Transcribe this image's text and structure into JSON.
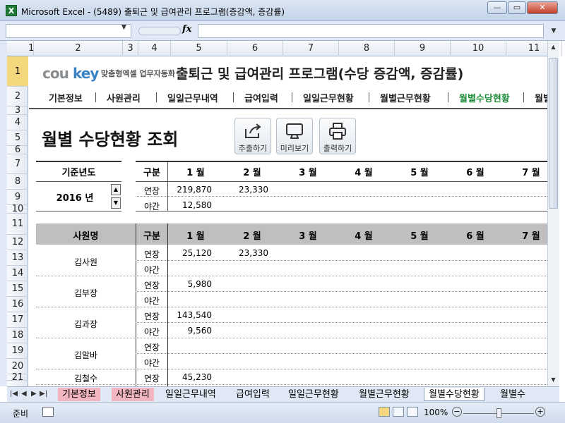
{
  "window": {
    "title": "Microsoft Excel - (5489) 출퇴근 및 급여관리 프로그램(증감액, 증감률)",
    "icon_letter": "X",
    "minimize": "—",
    "restore": "▭",
    "close": "✕"
  },
  "formula_bar": {
    "name_box": "",
    "fx": "fx",
    "formula": ""
  },
  "columns": [
    "1",
    "2",
    "3",
    "4",
    "5",
    "6",
    "7",
    "8",
    "9",
    "10",
    "11"
  ],
  "rows": [
    "1",
    "2",
    "3",
    "4",
    "5",
    "6",
    "7",
    "8",
    "9",
    "10",
    "11",
    "12",
    "13",
    "14",
    "15",
    "16",
    "17",
    "18",
    "19",
    "20",
    "21"
  ],
  "sheet": {
    "logo_cou": "cou",
    "logo_key": "key",
    "logo_sub": "맞춤형엑셀 업무자동화",
    "app_title": "출퇴근 및 급여관리 프로그램(수당 증감액, 증감률)",
    "menu": [
      "기본정보",
      "사원관리",
      "일일근무내역",
      "급여입력",
      "일일근무현황",
      "월별근무현황",
      "월별수당현황",
      "월별"
    ],
    "active_menu_index": 6,
    "page_title": "월별 수당현황 조회",
    "buttons": {
      "export": "추출하기",
      "preview": "미리보기",
      "print": "출력하기"
    },
    "summary": {
      "year_header": "기준년도",
      "year_value": "2016 년",
      "type_header": "구분",
      "months": [
        "1 월",
        "2 월",
        "3 월",
        "4 월",
        "5 월",
        "6 월",
        "7 월"
      ],
      "rows": [
        {
          "type": "연장",
          "values": [
            "219,870",
            "23,330",
            "",
            "",
            "",
            "",
            ""
          ]
        },
        {
          "type": "야간",
          "values": [
            "12,580",
            "",
            "",
            "",
            "",
            "",
            ""
          ]
        }
      ]
    },
    "detail": {
      "name_header": "사원명",
      "type_header": "구분",
      "employees": [
        {
          "name": "김사원",
          "rows": [
            {
              "type": "연장",
              "values": [
                "25,120",
                "23,330"
              ]
            },
            {
              "type": "야간",
              "values": [
                "",
                ""
              ]
            }
          ]
        },
        {
          "name": "김부장",
          "rows": [
            {
              "type": "연장",
              "values": [
                "5,980",
                ""
              ]
            },
            {
              "type": "야간",
              "values": [
                "",
                ""
              ]
            }
          ]
        },
        {
          "name": "김과장",
          "rows": [
            {
              "type": "연장",
              "values": [
                "143,540",
                ""
              ]
            },
            {
              "type": "야간",
              "values": [
                "9,560",
                ""
              ]
            }
          ]
        },
        {
          "name": "김알바",
          "rows": [
            {
              "type": "연장",
              "values": [
                "",
                ""
              ]
            },
            {
              "type": "야간",
              "values": [
                "",
                ""
              ]
            }
          ]
        },
        {
          "name": "김철수",
          "rows": [
            {
              "type": "연장",
              "values": [
                "45,230",
                ""
              ]
            }
          ]
        }
      ]
    }
  },
  "tabs": [
    "기본정보",
    "사원관리",
    "일일근무내역",
    "급여입력",
    "일일근무현황",
    "월별근무현황",
    "월별수당현황",
    "월별수"
  ],
  "active_tab_index": 6,
  "status": {
    "ready": "준비",
    "zoom": "100%"
  },
  "colors": {
    "accent_green": "#1f8c3a",
    "logo_blue": "#3a82c4",
    "tab_pink": "#f2b6c1",
    "header_grey": "#bfbfbf"
  }
}
